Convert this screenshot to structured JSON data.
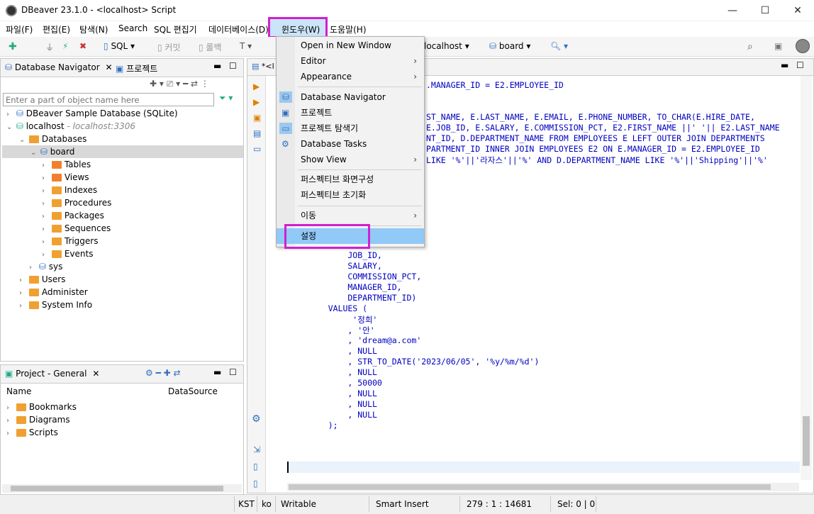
{
  "window": {
    "title": "DBeaver 23.1.0 - <localhost> Script",
    "minimize": "—",
    "maximize": "☐",
    "close": "✕"
  },
  "menubar": [
    "파일(F)",
    "편집(E)",
    "탐색(N)",
    "Search",
    "SQL 편집기",
    "데이터베이스(D)",
    "윈도우(W)",
    "도움말(H)"
  ],
  "toolbar": {
    "sql": "SQL",
    "commit": "커밋",
    "rollback": "롤백",
    "connection": "localhost",
    "schema": "board"
  },
  "navigator": {
    "tab_label": "Database Navigator",
    "tab2_label": "프로젝트",
    "filter_placeholder": "Enter a part of object name here",
    "tree": [
      {
        "label": "DBeaver Sample Database (SQLite)"
      },
      {
        "label": "localhost",
        "suffix": "- localhost:3306"
      },
      {
        "label": "Databases"
      },
      {
        "label": "board"
      },
      {
        "label": "Tables"
      },
      {
        "label": "Views"
      },
      {
        "label": "Indexes"
      },
      {
        "label": "Procedures"
      },
      {
        "label": "Packages"
      },
      {
        "label": "Sequences"
      },
      {
        "label": "Triggers"
      },
      {
        "label": "Events"
      },
      {
        "label": "sys"
      },
      {
        "label": "Users"
      },
      {
        "label": "Administer"
      },
      {
        "label": "System Info"
      }
    ]
  },
  "project": {
    "tab_label": "Project - General",
    "col_name": "Name",
    "col_datasource": "DataSource",
    "items": [
      "Bookmarks",
      "Diagrams",
      "Scripts"
    ]
  },
  "editor": {
    "tab_label": "*<l",
    "lines": [
      ".MANAGER_ID = E2.EMPLOYEE_ID",
      "ST_NAME, E.LAST_NAME, E.EMAIL, E.PHONE_NUMBER, TO_CHAR(E.HIRE_DATE,",
      "E.JOB_ID, E.SALARY, E.COMMISSION_PCT, E2.FIRST_NAME ||' '|| E2.LAST_NAME",
      "NT_ID, D.DEPARTMENT_NAME FROM EMPLOYEES E LEFT OUTER JOIN DEPARTMENTS",
      "PARTMENT_ID INNER JOIN EMPLOYEES E2 ON E.MANAGER_ID = E2.EMPLOYEE_ID",
      "LIKE '%'||'라자스'||'%' AND D.DEPARTMENT_NAME LIKE '%'||'Shipping'||'%'",
      "        JOB_ID,",
      "        SALARY,",
      "        COMMISSION_PCT,",
      "        MANAGER_ID,",
      "        DEPARTMENT_ID)",
      "    VALUES (",
      "         '정희'",
      "        , '안'",
      "        , 'dream@a.com'",
      "        , NULL",
      "        , STR_TO_DATE('2023/06/05', '%y/%m/%d')",
      "        , NULL",
      "        , 50000",
      "        , NULL",
      "        , NULL",
      "        , NULL",
      "    );"
    ]
  },
  "window_menu": {
    "items": [
      {
        "label": "Open in New Window",
        "submenu": false
      },
      {
        "label": "Editor",
        "submenu": true
      },
      {
        "label": "Appearance",
        "submenu": true
      },
      {
        "label": "Database Navigator",
        "submenu": false
      },
      {
        "label": "프로젝트",
        "submenu": false
      },
      {
        "label": "프로젝트 탐색기",
        "submenu": false
      },
      {
        "label": "Database Tasks",
        "submenu": false
      },
      {
        "label": "Show View",
        "submenu": true
      },
      {
        "label": "퍼스펙티브 화면구성",
        "submenu": false
      },
      {
        "label": "퍼스펙티브 초기화",
        "submenu": false
      },
      {
        "label": "이동",
        "submenu": true
      },
      {
        "label": "설정",
        "submenu": false,
        "highlighted": true
      }
    ],
    "arrow": "›"
  },
  "status": {
    "timezone": "KST",
    "locale": "ko",
    "mode": "Writable",
    "insert": "Smart Insert",
    "position": "279 : 1 : 14681",
    "selection": "Sel: 0 | 0"
  },
  "colors": {
    "accent": "#3070c0",
    "highlight_border": "#d020d0",
    "code": "#0000c0"
  }
}
